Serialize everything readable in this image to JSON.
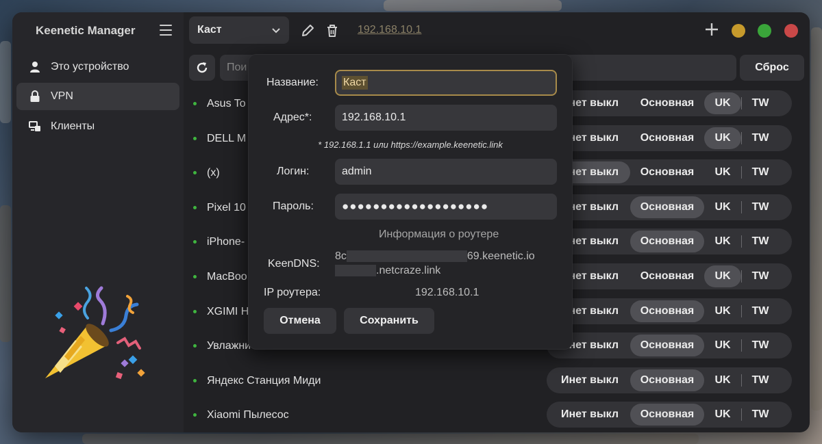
{
  "app": {
    "title": "Keenetic Manager"
  },
  "sidebar": {
    "items": [
      {
        "label": "Это устройство",
        "icon": "user-icon",
        "active": false
      },
      {
        "label": "VPN",
        "icon": "lock-icon",
        "active": true
      },
      {
        "label": "Клиенты",
        "icon": "devices-icon",
        "active": false
      }
    ]
  },
  "topbar": {
    "profile": "Каст",
    "address_link": "192.168.10.1"
  },
  "toolbar": {
    "search_placeholder": "Пои",
    "reset_label": "Сброс"
  },
  "segment_labels": [
    "Инет выкл",
    "Основная",
    "UK",
    "TW"
  ],
  "devices": [
    {
      "name": "Asus To",
      "selected": "UK"
    },
    {
      "name": "DELL M",
      "selected": "UK"
    },
    {
      "name": "(x)",
      "selected": "Инет выкл"
    },
    {
      "name": "Pixel 10",
      "selected": "Основная"
    },
    {
      "name": "iPhone-",
      "selected": "Основная"
    },
    {
      "name": "MacBoo",
      "selected": "UK"
    },
    {
      "name": "XGIMI H",
      "selected": "Основная"
    },
    {
      "name": "Увлажни",
      "selected": "Основная"
    },
    {
      "name": "Яндекс Станция Миди",
      "selected": "Основная"
    },
    {
      "name": "Xiaomi Пылесос",
      "selected": "Основная"
    }
  ],
  "dialog": {
    "name_label": "Название:",
    "name_value": "Каст",
    "address_label": "Адрес*:",
    "address_value": "192.168.10.1",
    "address_hint": "* 192.168.1.1 или https://example.keenetic.link",
    "login_label": "Логин:",
    "login_value": "admin",
    "password_label": "Пароль:",
    "password_value": "●●●●●●●●●●●●●●●●●●●",
    "info_heading": "Информация о роутере",
    "keendns_label": "KeenDNS:",
    "keendns_prefix": "8c",
    "keendns_suffix": "69.keenetic.io",
    "keendns_second_suffix": ".netcraze.link",
    "router_ip_label": "IP роутера:",
    "router_ip_value": "192.168.10.1",
    "cancel_label": "Отмена",
    "save_label": "Сохранить"
  },
  "colors": {
    "accent_focus": "#a88b4a",
    "online_dot": "#3fb53f",
    "win_minimize": "#c69a2c",
    "win_maximize": "#3aa53a",
    "win_close": "#c94848"
  }
}
